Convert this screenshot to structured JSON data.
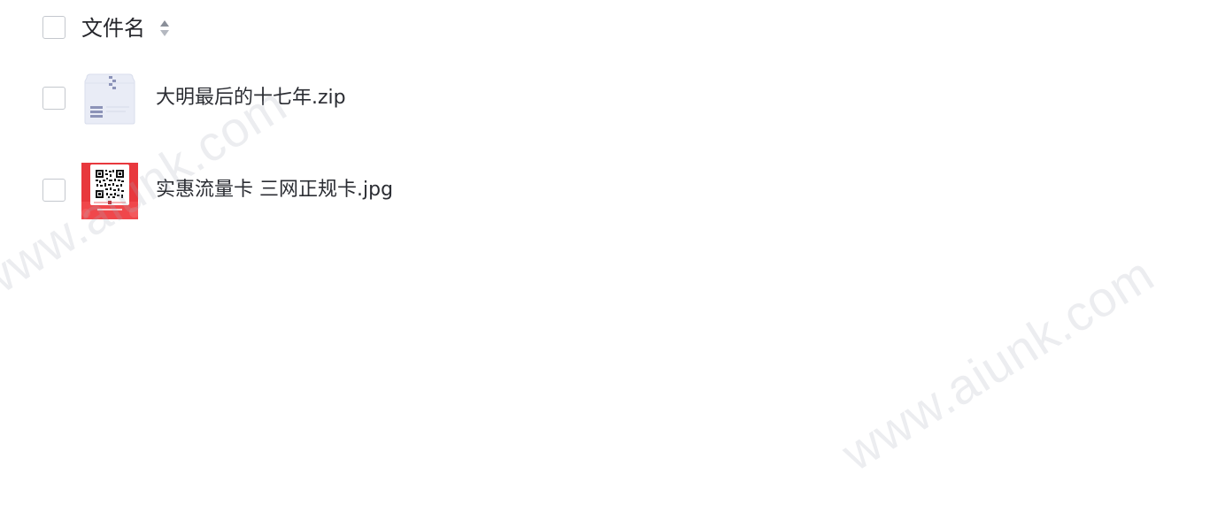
{
  "header": {
    "column_label": "文件名",
    "sort_icon": "sort-icon"
  },
  "files": [
    {
      "name": "大明最后的十七年.zip",
      "icon": "zip-file-icon"
    },
    {
      "name": "实惠流量卡 三网正规卡.jpg",
      "icon": "image-thumbnail"
    }
  ],
  "watermark": {
    "text": "www.aiunk.com"
  },
  "colors": {
    "text": "#2b2d33",
    "checkbox_border": "#c4c8ce",
    "zip_icon_bg": "#e9ecf6",
    "thumbnail_red": "#e8383d"
  }
}
